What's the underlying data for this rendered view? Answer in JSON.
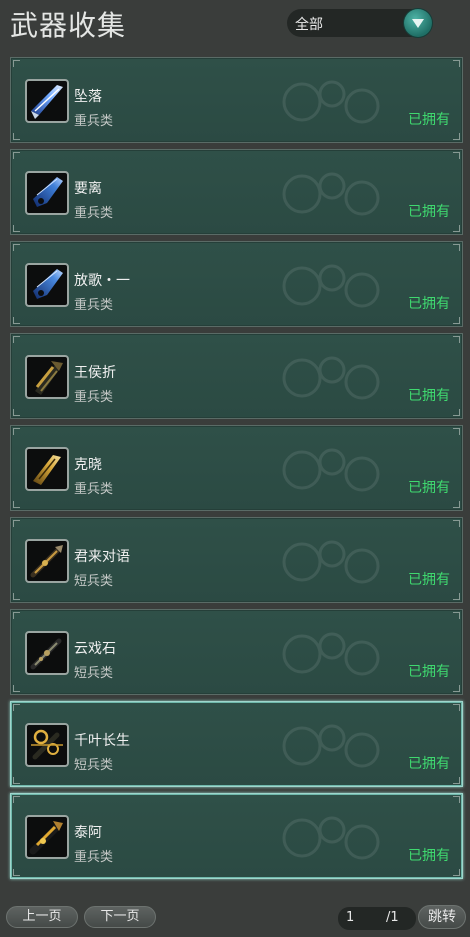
{
  "header": {
    "title": "武器收集",
    "filter_label": "全部",
    "filter_icon": "chevron-down-icon"
  },
  "items": [
    {
      "name": "坠落",
      "category": "重兵类",
      "status": "已拥有",
      "icon": "blade-icon"
    },
    {
      "name": "要离",
      "category": "重兵类",
      "status": "已拥有",
      "icon": "blade-icon"
    },
    {
      "name": "放歌・一",
      "category": "重兵类",
      "status": "已拥有",
      "icon": "blade-icon"
    },
    {
      "name": "王侯折",
      "category": "重兵类",
      "status": "已拥有",
      "icon": "heavy-weapon-icon"
    },
    {
      "name": "克晓",
      "category": "重兵类",
      "status": "已拥有",
      "icon": "heavy-weapon-icon"
    },
    {
      "name": "君来对语",
      "category": "短兵类",
      "status": "已拥有",
      "icon": "short-weapon-icon"
    },
    {
      "name": "云戏石",
      "category": "短兵类",
      "status": "已拥有",
      "icon": "short-weapon-icon"
    },
    {
      "name": "千叶长生",
      "category": "短兵类",
      "status": "已拥有",
      "icon": "short-weapon-icon"
    },
    {
      "name": "泰阿",
      "category": "重兵类",
      "status": "已拥有",
      "icon": "heavy-weapon-icon"
    }
  ],
  "footer": {
    "prev_label": "上一页",
    "next_label": "下一页",
    "page_current": "1",
    "page_total": "/1",
    "jump_label": "跳转"
  },
  "colors": {
    "owned": "#3fd86f",
    "panel": "#2f5048",
    "accent": "#4fb3a6"
  }
}
